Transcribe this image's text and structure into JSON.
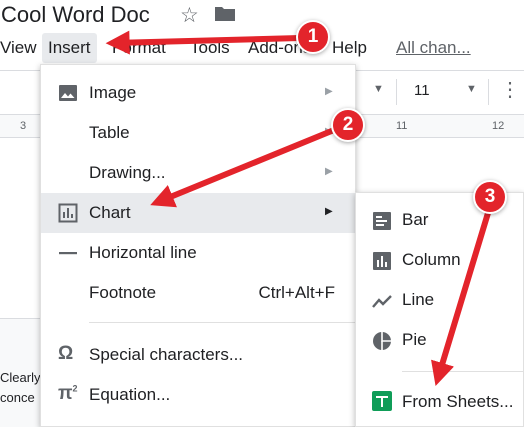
{
  "doc": {
    "title": "Cool Word Doc",
    "star_icon": "star-outline-icon",
    "folder_icon": "folder-icon"
  },
  "menubar": {
    "view": "View",
    "insert": "Insert",
    "format": "Format",
    "tools": "Tools",
    "addons": "Add-ons",
    "help": "Help",
    "all_changes": "All chan..."
  },
  "toolbar": {
    "font_size": "11",
    "more": "⋮"
  },
  "ruler": {
    "tick_3": "3",
    "tick_11": "11",
    "tick_12": "12"
  },
  "document": {
    "fragment_1": "Clearly",
    "fragment_2": "conce"
  },
  "insert_menu": {
    "items": [
      {
        "label": "Image",
        "icon": "image-icon",
        "has_submenu": true
      },
      {
        "label": "Table",
        "icon": "",
        "has_submenu": true
      },
      {
        "label": "Drawing...",
        "icon": "",
        "has_submenu": true
      },
      {
        "label": "Chart",
        "icon": "bar-chart-icon",
        "has_submenu": true,
        "highlighted": true
      },
      {
        "label": "Horizontal line",
        "icon": "horizontal-line-icon",
        "has_submenu": false
      },
      {
        "label": "Footnote",
        "icon": "",
        "has_submenu": false,
        "shortcut": "Ctrl+Alt+F"
      },
      {
        "label": "Special characters...",
        "icon": "omega-icon",
        "has_submenu": false
      },
      {
        "label": "Equation...",
        "icon": "pi-icon",
        "has_submenu": false
      }
    ]
  },
  "chart_submenu": {
    "items": [
      {
        "label": "Bar",
        "icon": "bar-chart-horizontal-icon"
      },
      {
        "label": "Column",
        "icon": "column-chart-icon"
      },
      {
        "label": "Line",
        "icon": "line-chart-icon"
      },
      {
        "label": "Pie",
        "icon": "pie-chart-icon"
      },
      {
        "label": "From Sheets...",
        "icon": "google-sheets-icon"
      }
    ]
  },
  "callouts": [
    "1",
    "2",
    "3"
  ],
  "colors": {
    "callout_red": "#e3242b",
    "menu_highlight": "#e8eaed",
    "sheets_green": "#0f9d58",
    "icon_gray": "#5f6368"
  }
}
